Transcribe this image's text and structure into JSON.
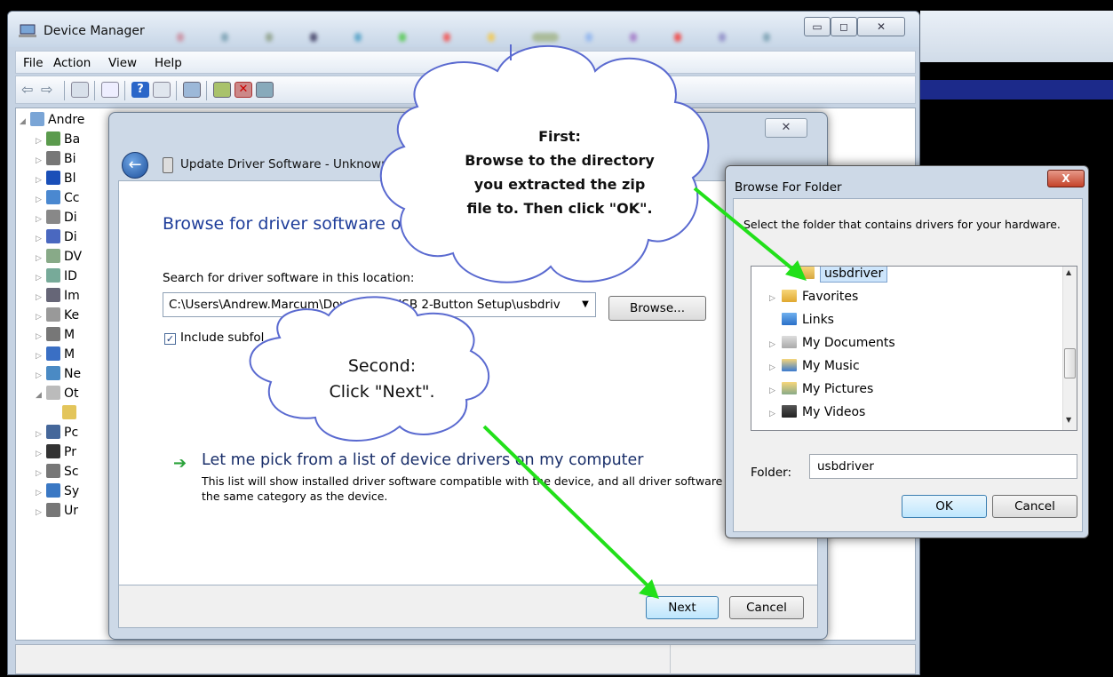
{
  "device_manager": {
    "title": "Device Manager",
    "menu": [
      "File",
      "Action",
      "View",
      "Help"
    ],
    "tree_root_label": "Andre",
    "tree_items": [
      "Ba",
      "Bi",
      "Bl",
      "Cc",
      "Di",
      "Di",
      "DV",
      "ID",
      "Im",
      "Ke",
      "M",
      "M",
      "Ne",
      "Ot",
      "",
      "Pc",
      "Pr",
      "Sc",
      "Sy",
      "Ur"
    ]
  },
  "update_driver": {
    "title": "Update Driver Software - Unknown De",
    "heading": "Browse for driver software on you",
    "search_label": "Search for driver software in this location:",
    "path_value": "C:\\Users\\Andrew.Marcum\\Downloads\\USB 2-Button Setup\\usbdriv",
    "browse_button": "Browse...",
    "include_subfolders": "Include subfol",
    "pick_title": "Let me pick from a list of device drivers on my computer",
    "pick_desc": "This list will show installed driver software compatible with the device, and all driver software in the same category as the device.",
    "next_button": "Next",
    "cancel_button": "Cancel",
    "close_glyph": "✕"
  },
  "browse_folder": {
    "title": "Browse For Folder",
    "close_glyph": "X",
    "description": "Select the folder that contains drivers for your hardware.",
    "items": [
      {
        "label": "usbdriver",
        "selected": true,
        "expandable": false
      },
      {
        "label": "Favorites",
        "selected": false,
        "expandable": true
      },
      {
        "label": "Links",
        "selected": false,
        "expandable": false
      },
      {
        "label": "My Documents",
        "selected": false,
        "expandable": true
      },
      {
        "label": "My Music",
        "selected": false,
        "expandable": true
      },
      {
        "label": "My Pictures",
        "selected": false,
        "expandable": true
      },
      {
        "label": "My Videos",
        "selected": false,
        "expandable": true
      }
    ],
    "folder_label": "Folder:",
    "folder_value": "usbdriver",
    "ok_button": "OK",
    "cancel_button": "Cancel"
  },
  "callouts": {
    "first": [
      "First:",
      "Browse to the directory",
      "you extracted the zip",
      "file to. Then click \"OK\"."
    ],
    "second": [
      "Second:",
      "Click \"Next\"."
    ]
  },
  "colors": {
    "accent_link": "#1e3d9a",
    "arrow": "#22e01a",
    "cloud_border": "#5a6ad0",
    "selection": "#cde5fb"
  }
}
